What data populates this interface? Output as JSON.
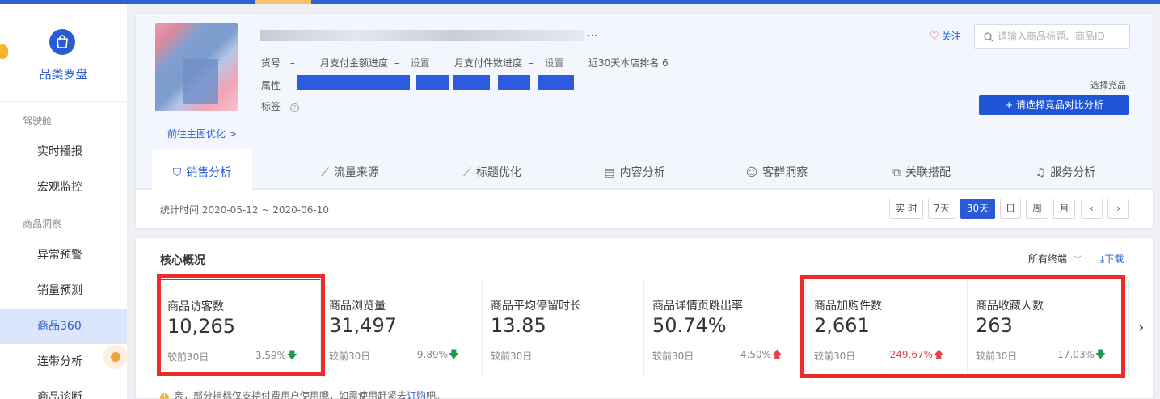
{
  "sidebar": {
    "title": "品类罗盘",
    "groups": [
      "驾驶舱",
      "商品洞察"
    ],
    "items": [
      {
        "label": "实时播报"
      },
      {
        "label": "宏观监控"
      },
      {
        "label": "异常预警"
      },
      {
        "label": "销量预测"
      },
      {
        "label": "商品360",
        "active": true
      },
      {
        "label": "连带分析"
      },
      {
        "label": "商品诊断"
      }
    ]
  },
  "product": {
    "title_suffix": "...",
    "meta": {
      "sku_label": "货号",
      "sku_value": "–",
      "amount_progress_label": "月支付金额进度",
      "amount_progress_value": "–",
      "amount_set": "设置",
      "count_progress_label": "月支付件数进度",
      "count_progress_value": "–",
      "count_set": "设置",
      "rank_text": "近30天本店排名 6",
      "attr_label": "属性",
      "tag_label": "标签",
      "tag_value": "–"
    },
    "goto_main_image": "前往主图优化 >",
    "follow_label": "关注",
    "search_placeholder": "请输入商品标题、商品ID",
    "pick_label": "选择竞品",
    "pick_button": "+ 请选择竞品对比分析"
  },
  "tabs": [
    {
      "label": "销售分析",
      "icon": "bag-icon",
      "active": true
    },
    {
      "label": "流量来源",
      "icon": "line-chart-icon"
    },
    {
      "label": "标题优化",
      "icon": "line-chart-icon"
    },
    {
      "label": "内容分析",
      "icon": "document-icon"
    },
    {
      "label": "客群洞察",
      "icon": "users-icon"
    },
    {
      "label": "关联搭配",
      "icon": "link-icon"
    },
    {
      "label": "服务分析",
      "icon": "headset-icon"
    }
  ],
  "stats": {
    "time_text": "统计时间 2020-05-12 ~ 2020-06-10",
    "ranges": [
      "实 时",
      "7天",
      "30天",
      "日",
      "周",
      "月"
    ],
    "active_range": "30天",
    "prev": "‹",
    "next": "›"
  },
  "core": {
    "title": "核心概况",
    "terminal": "所有终端",
    "download": "下载",
    "tip_prefix": "亲，部分指标仅支持付费用户使用哦，如需使用赶紧去",
    "tip_link": "订购",
    "tip_suffix": "吧。",
    "cards": [
      {
        "name": "商品访客数",
        "value": "10,265",
        "compare": "较前30日",
        "pct": "3.59%",
        "trend": "down"
      },
      {
        "name": "商品浏览量",
        "value": "31,497",
        "compare": "较前30日",
        "pct": "9.89%",
        "trend": "down"
      },
      {
        "name": "商品平均停留时长",
        "value": "13.85",
        "compare": "较前30日",
        "pct": "–",
        "trend": "none"
      },
      {
        "name": "商品详情页跳出率",
        "value": "50.74%",
        "compare": "较前30日",
        "pct": "4.50%",
        "trend": "up"
      },
      {
        "name": "商品加购件数",
        "value": "2,661",
        "compare": "较前30日",
        "pct": "249.67%",
        "trend": "up"
      },
      {
        "name": "商品收藏人数",
        "value": "263",
        "compare": "较前30日",
        "pct": "17.03%",
        "trend": "down"
      }
    ]
  },
  "colors": {
    "accent": "#2a5bd7",
    "highlight_border": "#ee2b2b",
    "up": "#e0424e",
    "down": "#1f9a4c"
  }
}
